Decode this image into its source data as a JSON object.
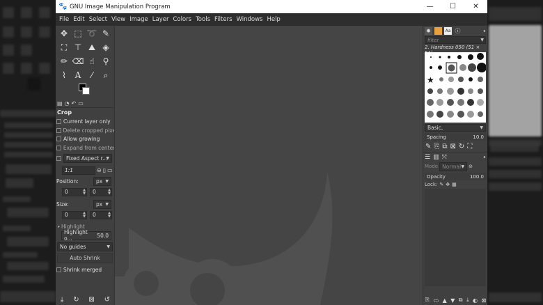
{
  "window": {
    "title": "GNU Image Manipulation Program",
    "minimize": "—",
    "maximize": "☐",
    "close": "✕"
  },
  "menu": [
    "File",
    "Edit",
    "Select",
    "View",
    "Image",
    "Layer",
    "Colors",
    "Tools",
    "Filters",
    "Windows",
    "Help"
  ],
  "tool_options": {
    "title": "Crop",
    "current_layer_only": "Current layer only",
    "delete_cropped": "Delete cropped pixels",
    "allow_growing": "Allow growing",
    "expand_from_center": "Expand from center",
    "fixed_aspect": "Fixed Aspect r...",
    "ratio": "1:1",
    "position_label": "Position:",
    "position_unit": "px",
    "position_x": "0",
    "position_y": "0",
    "size_label": "Size:",
    "size_unit": "px",
    "size_w": "0",
    "size_h": "0",
    "highlight": "Highlight",
    "highlight_opacity_label": "Highlight o...",
    "highlight_opacity_value": "50.0",
    "guides": "No guides",
    "auto_shrink": "Auto Shrink",
    "shrink_merged": "Shrink merged"
  },
  "brushes": {
    "filter_placeholder": "filter",
    "current_brush": "2. Hardness 050 (51 × 51)",
    "preset": "Basic,",
    "spacing_label": "Spacing",
    "spacing_value": "10.0"
  },
  "layers": {
    "mode_label": "Mode",
    "mode_value": "Normal",
    "opacity_label": "Opacity",
    "opacity_value": "100.0",
    "lock_label": "Lock:"
  },
  "colors": {
    "canvas": "#454545",
    "menubar": "#2e2e2e",
    "dock": "#404040",
    "wilber": "#505050"
  }
}
